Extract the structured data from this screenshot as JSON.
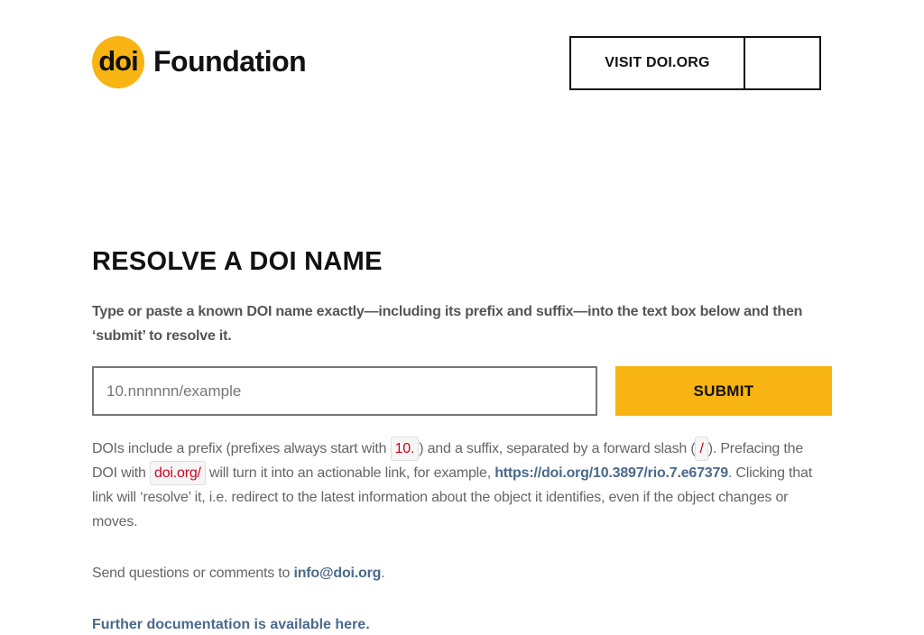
{
  "header": {
    "logo_badge": "doi",
    "logo_word": "Foundation",
    "visit_label": "VISIT DOI.ORG"
  },
  "main": {
    "title": "RESOLVE A DOI NAME",
    "intro": "Type or paste a known DOI name exactly—including its prefix and suffix—into the text box below and then ‘submit’ to resolve it.",
    "input_placeholder": "10.nnnnnn/example",
    "input_value": "",
    "submit_label": "SUBMIT"
  },
  "help": {
    "part1": "DOIs include a prefix (prefixes always start with ",
    "code_prefix": "10.",
    "part2": ") and a suffix, separated by a forward slash (",
    "code_slash": "/",
    "part3": "). Prefacing the DOI with ",
    "code_doiorg": "doi.org/",
    "part4": " will turn it into an actionable link, for example, ",
    "example_link": "https://doi.org/10.3897/rio.7.e67379",
    "part5": ". Clicking that link will ‘resolve’ it, i.e. redirect to the latest information about the object it identifies, even if the object changes or moves."
  },
  "contact": {
    "text": "Send questions or comments to ",
    "email": "info@doi.org",
    "end": "."
  },
  "docs": {
    "link_text": "Further documentation is available here."
  },
  "colors": {
    "brand_yellow": "#f8b413",
    "link": "#4a6a8c",
    "code_text": "#d0021b"
  }
}
